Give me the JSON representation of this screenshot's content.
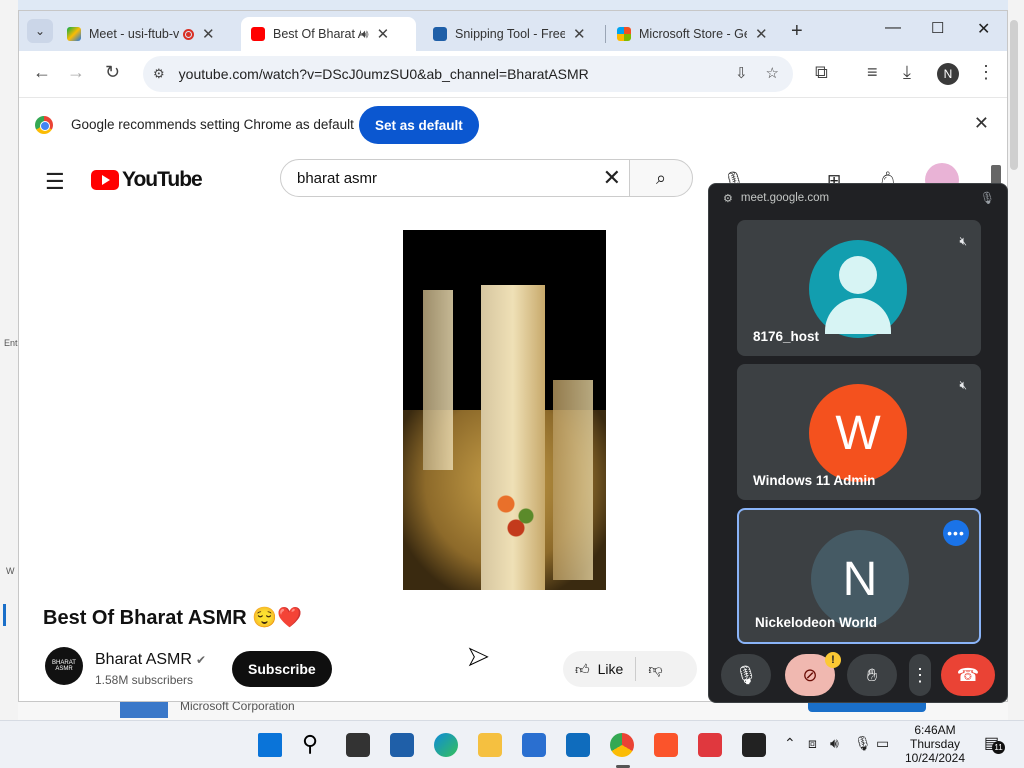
{
  "tabs": [
    {
      "title": "Meet - usi-ftub-v",
      "active": false,
      "recording": true
    },
    {
      "title": "Best Of Bharat A",
      "active": true,
      "audio": true
    },
    {
      "title": "Snipping Tool - Free",
      "active": false
    },
    {
      "title": "Microsoft Store - Ge",
      "active": false
    }
  ],
  "toolbar": {
    "url": "youtube.com/watch?v=DScJ0umzSU0&ab_channel=BharatASMR"
  },
  "infobar": {
    "message": "Google recommends setting Chrome as default",
    "button": "Set as default"
  },
  "youtube": {
    "logo": "YouTube",
    "search_value": "bharat asmr",
    "video_title": "Best Of Bharat ASMR",
    "video_title_emoji": "😌❤️",
    "channel_name": "Bharat ASMR",
    "subscribers": "1.58M subscribers",
    "subscribe_label": "Subscribe",
    "like_label": "Like",
    "channel_avatar_text": "BHARAT ASMR"
  },
  "meet": {
    "domain": "meet.google.com",
    "participants": [
      {
        "name": "8176_host",
        "initial": "",
        "color": "#129eaf",
        "muted": true
      },
      {
        "name": "Windows 11 Admin",
        "initial": "W",
        "color": "#f4511e",
        "muted": true
      },
      {
        "name": "Nickelodeon World",
        "initial": "N",
        "color": "#455a64",
        "muted": false,
        "selected": true
      }
    ],
    "warning_badge": "!"
  },
  "desktop": {
    "background_window_text": "Microsoft Corporation",
    "edge_left_1": "Ent",
    "edge_left_2": "W"
  },
  "taskbar": {
    "time": "6:46AM",
    "day": "Thursday",
    "date": "10/24/2024",
    "notifications": "11"
  }
}
